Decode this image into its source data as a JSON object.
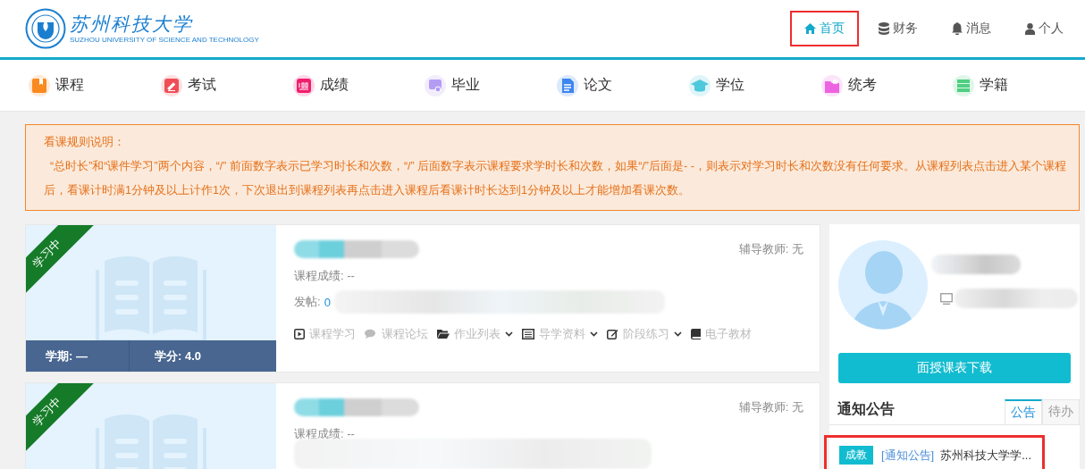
{
  "logo": {
    "name_cn": "苏州科技大学",
    "name_en": "SUZHOU UNIVERSITY OF SCIENCE AND TECHNOLOGY"
  },
  "top_nav": [
    {
      "label": "首页",
      "kind": "home",
      "selected": true,
      "highlighted": true
    },
    {
      "label": "财务",
      "kind": "finance",
      "selected": false,
      "highlighted": false
    },
    {
      "label": "消息",
      "kind": "messages",
      "selected": false,
      "highlighted": false
    },
    {
      "label": "个人",
      "kind": "personal",
      "selected": false,
      "highlighted": false
    }
  ],
  "modules": [
    {
      "label": "课程",
      "kind": "course",
      "color": "#f98a20"
    },
    {
      "label": "考试",
      "kind": "exam",
      "color": "#ef4e57"
    },
    {
      "label": "成绩",
      "kind": "grades",
      "color": "#f01f6e"
    },
    {
      "label": "毕业",
      "kind": "graduation",
      "color": "#b49cf5"
    },
    {
      "label": "论文",
      "kind": "thesis",
      "color": "#3d85f0"
    },
    {
      "label": "学位",
      "kind": "degree",
      "color": "#4ec9dc"
    },
    {
      "label": "统考",
      "kind": "unified",
      "color": "#ee63e2"
    },
    {
      "label": "学籍",
      "kind": "records",
      "color": "#4fcf82"
    }
  ],
  "notice": {
    "title": "看课规则说明：",
    "text": "“总时长”和“课件学习”两个内容，“/” 前面数字表示已学习时长和次数，“/” 后面数字表示课程要求学时长和次数，如果“/”后面是- -，则表示对学习时长和次数没有任何要求。从课程列表点击进入某个课程后，看课计时满1分钟及以上计作1次，下次退出到课程列表再点击进入课程后看课计时长达到1分钟及以上才能增加看课次数。"
  },
  "courses": [
    {
      "status": "学习中",
      "term": "学期: —",
      "credit": "学分: 4.0",
      "tutor": "辅导教师: 无",
      "score": "课程成绩: --",
      "posts_label": "发帖:",
      "posts": "0",
      "actions": [
        {
          "label": "课程学习",
          "kind": "study",
          "dropdown": false
        },
        {
          "label": "课程论坛",
          "kind": "forum",
          "dropdown": false
        },
        {
          "label": "作业列表",
          "kind": "homework",
          "dropdown": true
        },
        {
          "label": "导学资料",
          "kind": "materials",
          "dropdown": true
        },
        {
          "label": "阶段练习",
          "kind": "practice",
          "dropdown": true
        },
        {
          "label": "电子教材",
          "kind": "textbook",
          "dropdown": false
        }
      ]
    },
    {
      "status": "学习中",
      "tutor": "辅导教师: 无",
      "score": "课程成绩: --"
    }
  ],
  "profile": {
    "button": "面授课表下载"
  },
  "announcements": {
    "title": "通知公告",
    "tabs": [
      {
        "label": "公告",
        "selected": true
      },
      {
        "label": "待办",
        "selected": false
      }
    ],
    "items": [
      {
        "tag": "成教",
        "category": "[通知公告]",
        "title": "苏州科技大学学...",
        "highlighted": true
      }
    ]
  }
}
